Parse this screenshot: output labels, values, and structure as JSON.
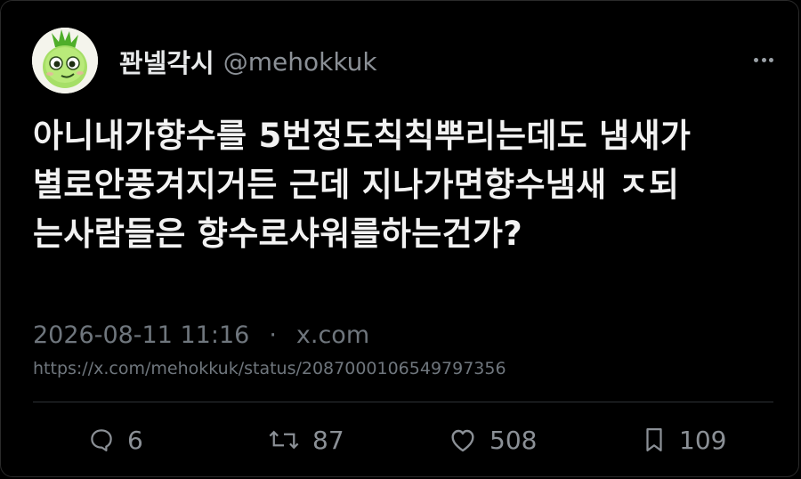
{
  "author": {
    "display_name": "꽌넬각시",
    "handle": "@mehokkuk",
    "avatar_icon": "green-sprout-character-avatar"
  },
  "tweet": {
    "lines": [
      "아니내가향수를 5번정도칙칙뿌리는데도 냄새가",
      "별로안풍겨지거든 근데 지나가면향수냄새 ㅈ되",
      "는사람들은 향수로샤워를하는건가?"
    ]
  },
  "meta": {
    "timestamp": "2026-08-11 11:16",
    "separator": "·",
    "source": "x.com",
    "url": "https://x.com/mehokkuk/status/2087000106549797356"
  },
  "actions": {
    "replies": "6",
    "reposts": "87",
    "likes": "508",
    "bookmarks": "109"
  },
  "icons": {
    "more": "more-horizontal-icon",
    "reply": "speech-bubble-icon",
    "repost": "repost-arrows-icon",
    "like": "heart-icon",
    "bookmark": "bookmark-icon"
  },
  "colors": {
    "background": "#000000",
    "text_primary": "#e7e9ea",
    "text_secondary": "#6f767d",
    "avatar_green": "#7ccf3a"
  }
}
